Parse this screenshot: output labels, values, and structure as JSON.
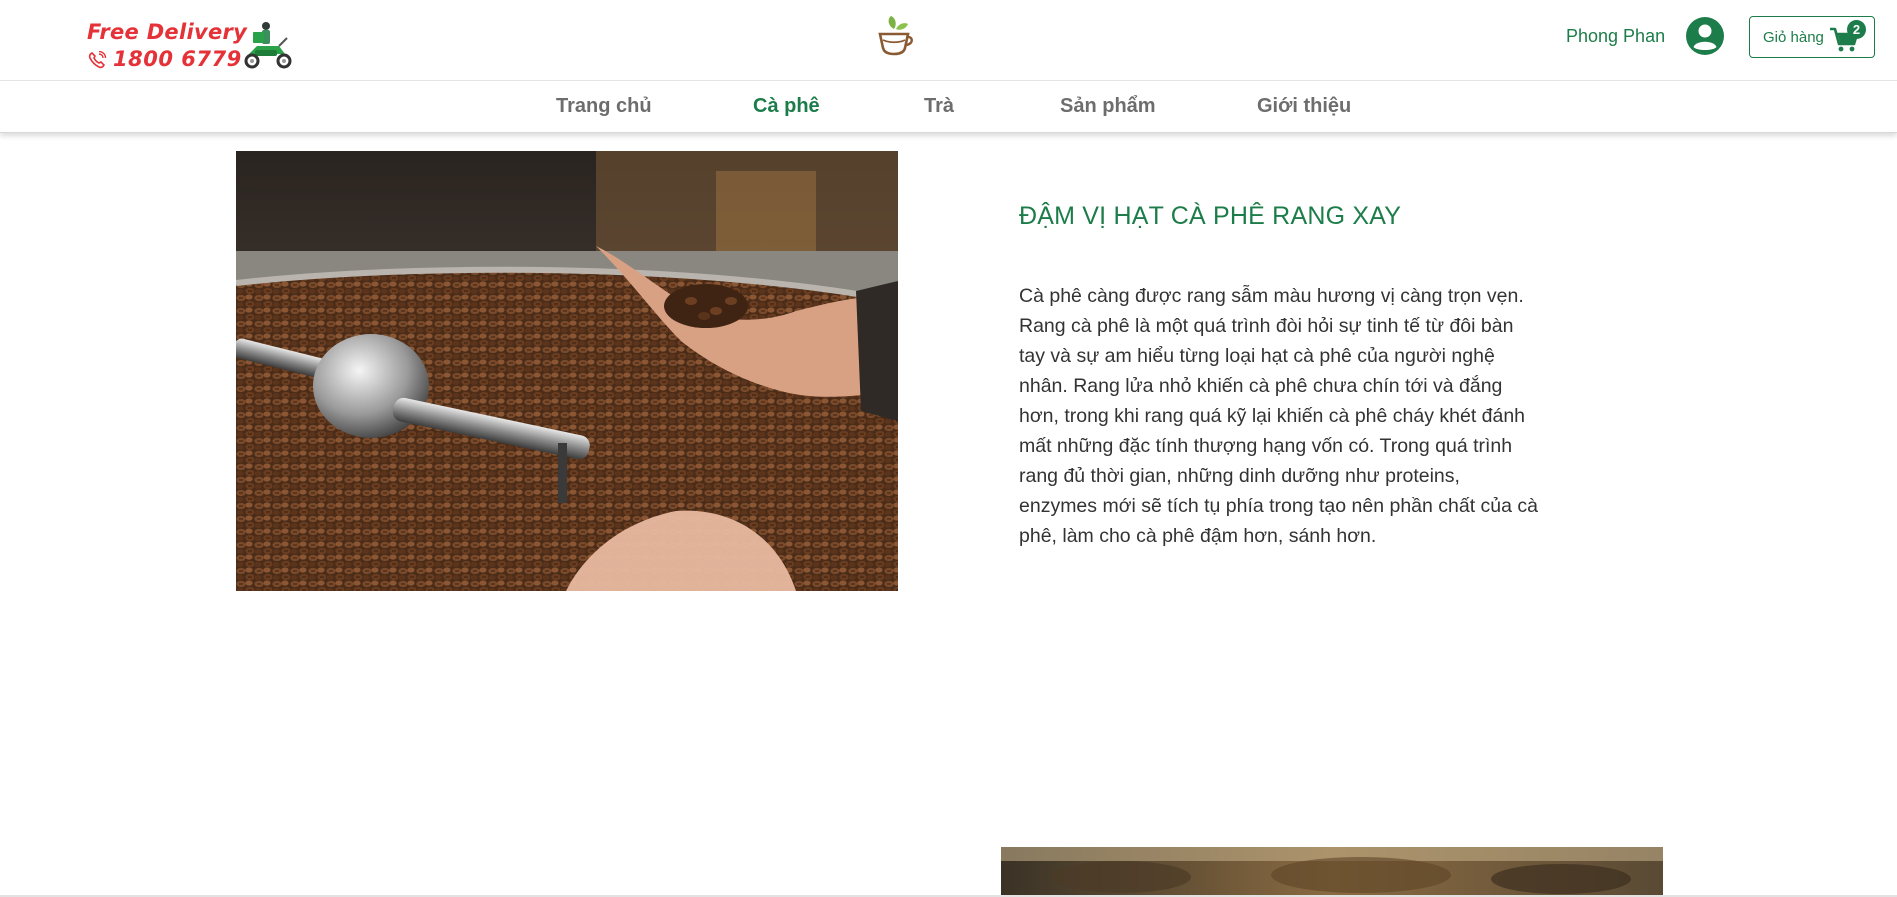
{
  "promo": {
    "line1": "Free Delivery",
    "line2": "1800 6779",
    "icons": [
      "phone-icon",
      "delivery-scooter-icon"
    ],
    "color": "#e53238"
  },
  "brand": {
    "logo_icon": "coffee-cup-leaf-icon"
  },
  "account": {
    "user_name": "Phong Phan",
    "avatar_icon": "user-circle-icon",
    "cart_label": "Giỏ hàng",
    "cart_count": "2",
    "cart_icon": "shopping-cart-icon"
  },
  "nav": {
    "items": [
      {
        "label": "Trang chủ",
        "active": false
      },
      {
        "label": "Cà phê",
        "active": true
      },
      {
        "label": "Trà",
        "active": false
      },
      {
        "label": "Sản phẩm",
        "active": false
      },
      {
        "label": "Giới thiệu",
        "active": false
      }
    ]
  },
  "feature": {
    "image": "coffee-roasting-beans-photo",
    "title": "ĐẬM VỊ HẠT CÀ PHÊ RANG XAY",
    "body": "Cà phê càng được rang sẫm màu hương vị càng trọn vẹn. Rang cà phê là một quá trình đòi hỏi sự tinh tế từ đôi bàn tay và sự am hiểu từng loại hạt cà phê của người nghệ nhân. Rang lửa nhỏ khiến cà phê chưa chín tới và đắng hơn, trong khi rang quá kỹ lại khiến cà phê cháy khét đánh mất những đặc tính thượng hạng vốn có. Trong quá trình rang đủ thời gian, những dinh dưỡng như proteins, enzymes mới sẽ tích tụ phía trong tạo nên phần chất của cà phê, làm cho cà phê đậm hơn, sánh hơn."
  },
  "colors": {
    "brand_green": "#1d7d4a",
    "nav_text": "#6d6d6d",
    "body_text": "#333333"
  }
}
